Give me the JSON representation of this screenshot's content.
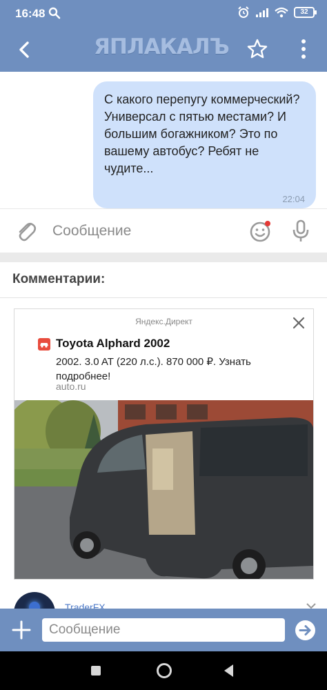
{
  "status_bar": {
    "time": "16:48",
    "battery": "32",
    "icons": [
      "search-icon",
      "alarm-icon",
      "signal-icon",
      "wifi-icon",
      "battery-icon"
    ]
  },
  "app_bar": {
    "logo": "ЯПЛАКАЛЪ",
    "icons": [
      "back-arrow-icon",
      "star-icon",
      "more-vertical-icon"
    ]
  },
  "message": {
    "text": "С какого перепугу коммерческий? Универсал с пятью местами? И большим богажником? Это по вашему автобус? Ребят не чудите...",
    "time": "22:04"
  },
  "compose_top": {
    "placeholder": "Сообщение",
    "icons": [
      "attach-icon",
      "emoji-icon",
      "mic-icon"
    ]
  },
  "comments": {
    "heading": "Комментарии:"
  },
  "ad": {
    "source": "Яндекс.Директ",
    "title": "Toyota Alphard 2002",
    "description": "2002. 3.0 AT (220 л.с.). 870 000 ₽. Узнать подробнее!",
    "domain": "auto.ru"
  },
  "comment_preview": {
    "author": "TraderFX"
  },
  "bottom_bar": {
    "placeholder": "Сообщение",
    "icons": [
      "plus-icon",
      "send-icon"
    ]
  },
  "colors": {
    "bar": "#6f8fbf",
    "bubble": "#cfe1fb",
    "link": "#4f7bc8"
  }
}
